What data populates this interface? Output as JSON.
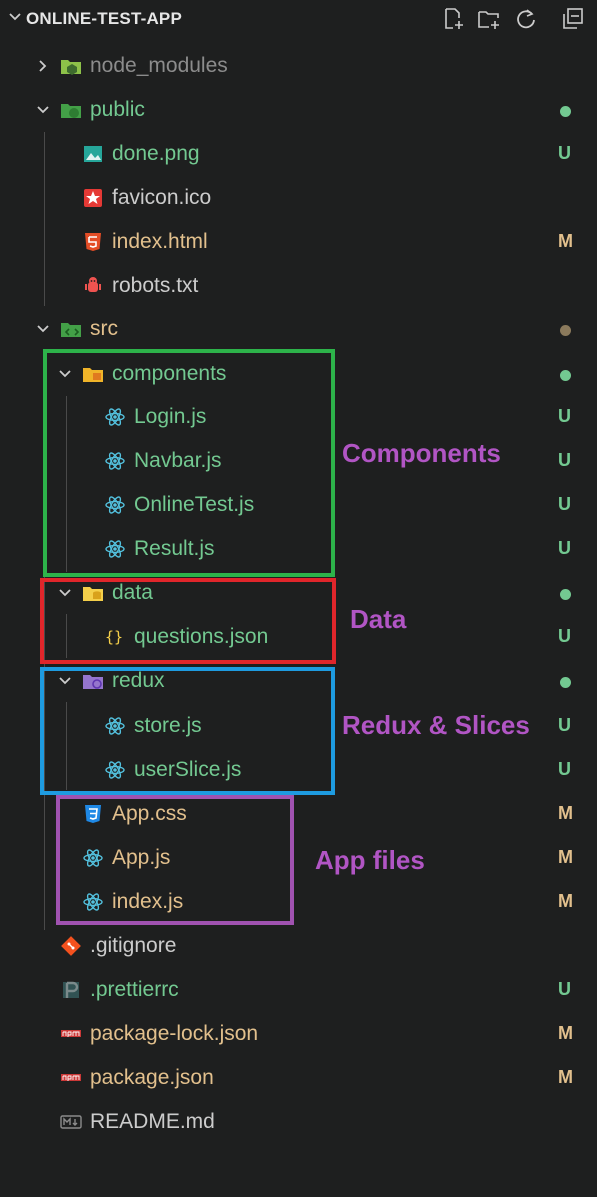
{
  "explorer": {
    "title": "ONLINE-TEST-APP",
    "header_buttons": [
      "new-file-icon",
      "new-folder-icon",
      "refresh-icon",
      "collapse-all-icon"
    ],
    "items": [
      {
        "label": "node_modules",
        "kind": "folder",
        "expanded": false,
        "badge": "",
        "dot": "",
        "color": "#8c8c8c",
        "icon": "node-folder-icon"
      },
      {
        "label": "public",
        "kind": "folder",
        "expanded": true,
        "badge": "",
        "dot": "#73c991",
        "color": "#73c991",
        "icon": "public-folder-icon"
      },
      {
        "label": "done.png",
        "kind": "file",
        "badge": "U",
        "color": "#73c991",
        "icon": "image-icon"
      },
      {
        "label": "favicon.ico",
        "kind": "file",
        "badge": "",
        "color": "#cccccc",
        "icon": "favicon-icon"
      },
      {
        "label": "index.html",
        "kind": "file",
        "badge": "M",
        "color": "#e2c08d",
        "icon": "html-icon"
      },
      {
        "label": "robots.txt",
        "kind": "file",
        "badge": "",
        "color": "#cccccc",
        "icon": "robot-icon"
      },
      {
        "label": "src",
        "kind": "folder",
        "expanded": true,
        "badge": "",
        "dot": "#8b7a5c",
        "color": "#e2c08d",
        "icon": "src-folder-icon"
      },
      {
        "label": "components",
        "kind": "folder",
        "expanded": true,
        "badge": "",
        "dot": "#73c991",
        "color": "#73c991",
        "icon": "components-folder-icon"
      },
      {
        "label": "Login.js",
        "kind": "file",
        "badge": "U",
        "color": "#73c991",
        "icon": "react-icon"
      },
      {
        "label": "Navbar.js",
        "kind": "file",
        "badge": "U",
        "color": "#73c991",
        "icon": "react-icon"
      },
      {
        "label": "OnlineTest.js",
        "kind": "file",
        "badge": "U",
        "color": "#73c991",
        "icon": "react-icon"
      },
      {
        "label": "Result.js",
        "kind": "file",
        "badge": "U",
        "color": "#73c991",
        "icon": "react-icon"
      },
      {
        "label": "data",
        "kind": "folder",
        "expanded": true,
        "badge": "",
        "dot": "#73c991",
        "color": "#73c991",
        "icon": "data-folder-icon"
      },
      {
        "label": "questions.json",
        "kind": "file",
        "badge": "U",
        "color": "#73c991",
        "icon": "json-icon"
      },
      {
        "label": "redux",
        "kind": "folder",
        "expanded": true,
        "badge": "",
        "dot": "#73c991",
        "color": "#73c991",
        "icon": "redux-folder-icon"
      },
      {
        "label": "store.js",
        "kind": "file",
        "badge": "U",
        "color": "#73c991",
        "icon": "react-icon"
      },
      {
        "label": "userSlice.js",
        "kind": "file",
        "badge": "U",
        "color": "#73c991",
        "icon": "react-icon"
      },
      {
        "label": "App.css",
        "kind": "file",
        "badge": "M",
        "color": "#e2c08d",
        "icon": "css-icon"
      },
      {
        "label": "App.js",
        "kind": "file",
        "badge": "M",
        "color": "#e2c08d",
        "icon": "react-icon"
      },
      {
        "label": "index.js",
        "kind": "file",
        "badge": "M",
        "color": "#e2c08d",
        "icon": "react-icon"
      },
      {
        "label": ".gitignore",
        "kind": "file",
        "badge": "",
        "color": "#cccccc",
        "icon": "git-icon"
      },
      {
        "label": ".prettierrc",
        "kind": "file",
        "badge": "U",
        "color": "#73c991",
        "icon": "prettier-icon"
      },
      {
        "label": "package-lock.json",
        "kind": "file",
        "badge": "M",
        "color": "#e2c08d",
        "icon": "npm-icon"
      },
      {
        "label": "package.json",
        "kind": "file",
        "badge": "M",
        "color": "#e2c08d",
        "icon": "npm-icon"
      },
      {
        "label": "README.md",
        "kind": "file",
        "badge": "",
        "color": "#cccccc",
        "icon": "markdown-icon"
      }
    ]
  },
  "annotations": [
    {
      "text": "Components",
      "box_color": "#2db34a"
    },
    {
      "text": "Data",
      "box_color": "#e0262b"
    },
    {
      "text": "Redux & Slices",
      "box_color": "#1e9be0"
    },
    {
      "text": "App files",
      "box_color": "#a052b0"
    }
  ]
}
